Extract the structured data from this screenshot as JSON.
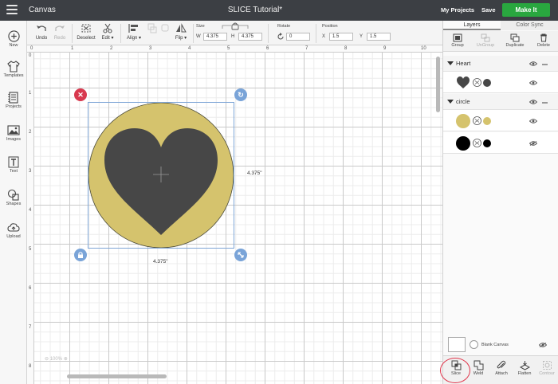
{
  "header": {
    "app_title": "Canvas",
    "doc_title": "SLICE Tutorial*",
    "my_projects": "My Projects",
    "save": "Save",
    "make_it": "Make It",
    "brand_green": "#29a73f"
  },
  "toolbar": {
    "undo": "Undo",
    "redo": "Redo",
    "deselect": "Deselect",
    "edit": "Edit",
    "align": "Align",
    "flip": "Flip",
    "size_label": "Size",
    "w_key": "W",
    "w_value": "4.375",
    "h_key": "H",
    "h_value": "4.375",
    "rotate_label": "Rotate",
    "rotate_value": "0",
    "position_label": "Position",
    "x_key": "X",
    "x_value": "1.5",
    "y_key": "Y",
    "y_value": "1.5"
  },
  "sidebar": {
    "items": [
      {
        "label": "New",
        "icon": "plus-icon"
      },
      {
        "label": "Templates",
        "icon": "tshirt-icon"
      },
      {
        "label": "Projects",
        "icon": "projects-icon"
      },
      {
        "label": "Images",
        "icon": "image-icon"
      },
      {
        "label": "Text",
        "icon": "text-icon"
      },
      {
        "label": "Shapes",
        "icon": "shapes-icon"
      },
      {
        "label": "Upload",
        "icon": "upload-icon"
      }
    ]
  },
  "canvas": {
    "ruler_top": [
      "0",
      "1",
      "2",
      "3",
      "4",
      "5",
      "6",
      "7",
      "8",
      "9",
      "10"
    ],
    "ruler_left": [
      "0",
      "1",
      "2",
      "3",
      "4",
      "5",
      "6",
      "7",
      "8",
      "9"
    ],
    "width_label": "4.375\"",
    "height_label": "4.375\"",
    "zoom": "100%",
    "circle_color": "#d5c36d",
    "heart_color": "#474747"
  },
  "layers_panel": {
    "tab_layers": "Layers",
    "tab_color_sync": "Color Sync",
    "actions": {
      "group": "Group",
      "ungroup": "UnGroup",
      "duplicate": "Duplicate",
      "delete": "Delete"
    },
    "groups": [
      {
        "name": "Heart",
        "layers": [
          {
            "swatch": "#474747",
            "dot": "#474747"
          }
        ]
      },
      {
        "name": "circle",
        "layers": [
          {
            "swatch": "#d5c36d",
            "dot": "#d5c36d"
          },
          {
            "swatch": "#000000",
            "dot": "#000000"
          }
        ]
      }
    ],
    "blank_canvas": "Blank Canvas",
    "bottom": {
      "slice": "Slice",
      "weld": "Weld",
      "attach": "Attach",
      "flatten": "Flatten",
      "contour": "Contour"
    }
  }
}
